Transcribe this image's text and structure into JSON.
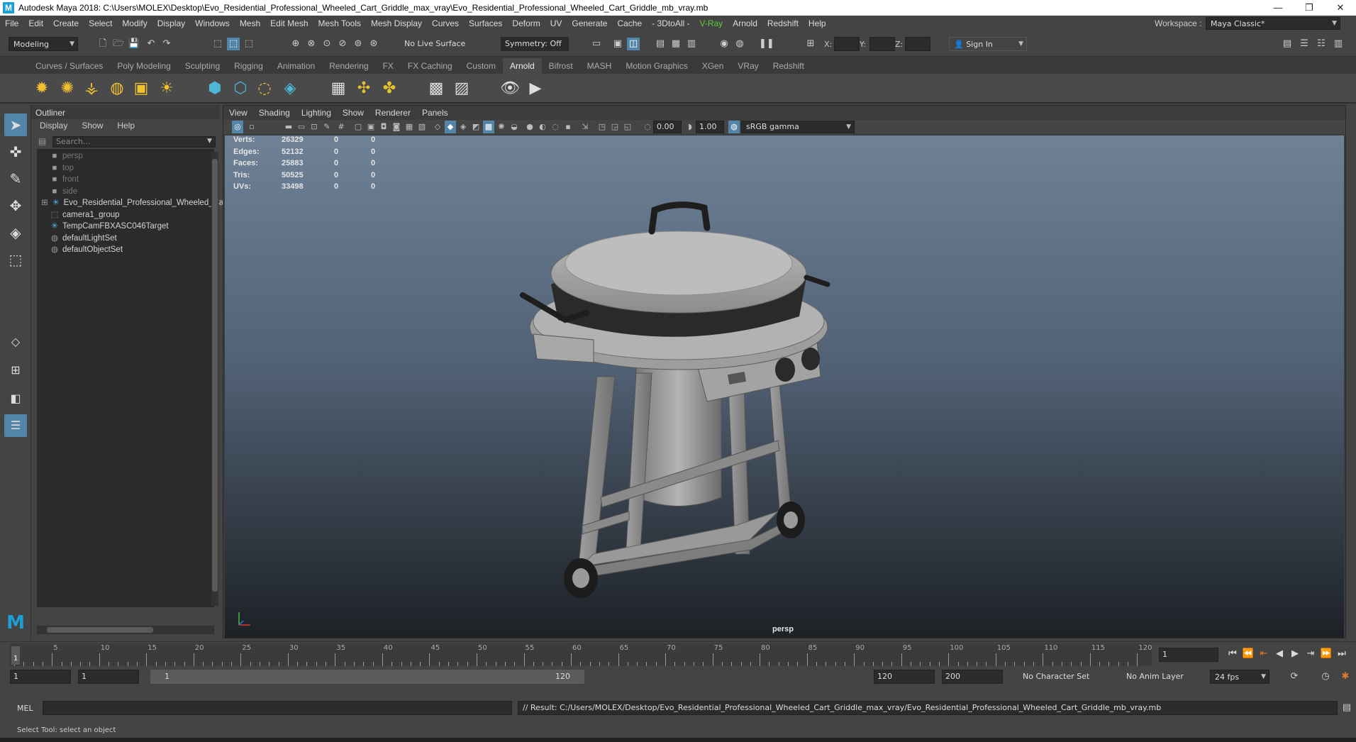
{
  "window": {
    "title": "Autodesk Maya 2018: C:\\Users\\MOLEX\\Desktop\\Evo_Residential_Professional_Wheeled_Cart_Griddle_max_vray\\Evo_Residential_Professional_Wheeled_Cart_Griddle_mb_vray.mb",
    "logo": "M",
    "minimize": "—",
    "maximize": "❐",
    "close": "✕"
  },
  "menubar": [
    "File",
    "Edit",
    "Create",
    "Select",
    "Modify",
    "Display",
    "Windows",
    "Mesh",
    "Edit Mesh",
    "Mesh Tools",
    "Mesh Display",
    "Curves",
    "Surfaces",
    "Deform",
    "UV",
    "Generate",
    "Cache",
    "- 3DtoAll -",
    "V-Ray",
    "Arnold",
    "Redshift",
    "Help"
  ],
  "workspace": {
    "label": "Workspace :",
    "value": "Maya Classic*"
  },
  "statusline": {
    "mode": "Modeling",
    "live_surface": "No Live Surface",
    "symmetry": "Symmetry: Off",
    "x_label": "X:",
    "y_label": "Y:",
    "z_label": "Z:",
    "sign_in": "Sign In"
  },
  "shelf_tabs": [
    "Curves / Surfaces",
    "Poly Modeling",
    "Sculpting",
    "Rigging",
    "Animation",
    "Rendering",
    "FX",
    "FX Caching",
    "Custom",
    "Arnold",
    "Bifrost",
    "MASH",
    "Motion Graphics",
    "XGen",
    "VRay",
    "Redshift"
  ],
  "shelf_active": "Arnold",
  "outliner": {
    "title": "Outliner",
    "menu": [
      "Display",
      "Show",
      "Help"
    ],
    "search_placeholder": "Search...",
    "items": [
      {
        "label": "persp",
        "dim": true,
        "icon": "camera-icon"
      },
      {
        "label": "top",
        "dim": true,
        "icon": "camera-icon"
      },
      {
        "label": "front",
        "dim": true,
        "icon": "camera-icon"
      },
      {
        "label": "side",
        "dim": true,
        "icon": "camera-icon"
      },
      {
        "label": "Evo_Residential_Professional_Wheeled_Cart_Griddle",
        "dim": false,
        "icon": "transform-icon"
      },
      {
        "label": "camera1_group",
        "dim": false,
        "icon": "group-icon"
      },
      {
        "label": "TempCamFBXASC046Target",
        "dim": false,
        "icon": "transform-icon"
      },
      {
        "label": "defaultLightSet",
        "dim": false,
        "icon": "set-icon"
      },
      {
        "label": "defaultObjectSet",
        "dim": false,
        "icon": "set-icon"
      }
    ]
  },
  "viewport": {
    "menu": [
      "View",
      "Shading",
      "Lighting",
      "Show",
      "Renderer",
      "Panels"
    ],
    "exposure": "0.00",
    "gamma": "1.00",
    "color_space": "sRGB gamma",
    "camera": "persp",
    "hud": [
      {
        "label": "Verts:",
        "a": "26329",
        "b": "0",
        "c": "0"
      },
      {
        "label": "Edges:",
        "a": "52132",
        "b": "0",
        "c": "0"
      },
      {
        "label": "Faces:",
        "a": "25883",
        "b": "0",
        "c": "0"
      },
      {
        "label": "Tris:",
        "a": "50525",
        "b": "0",
        "c": "0"
      },
      {
        "label": "UVs:",
        "a": "33498",
        "b": "0",
        "c": "0"
      }
    ]
  },
  "timeslider": {
    "ticks": [
      "5",
      "10",
      "15",
      "20",
      "25",
      "30",
      "35",
      "40",
      "45",
      "50",
      "55",
      "60",
      "65",
      "70",
      "75",
      "80",
      "85",
      "90",
      "95",
      "100",
      "105",
      "110",
      "115",
      "120"
    ],
    "current_frame": "1",
    "frame_field": "1"
  },
  "range": {
    "start": "1",
    "anim_start": "1",
    "slider_start": "1",
    "slider_end": "120",
    "anim_end": "120",
    "end": "200",
    "character_set": "No Character Set",
    "anim_layer": "No Anim Layer",
    "fps": "24 fps"
  },
  "cmdline": {
    "lang": "MEL",
    "result": "// Result: C:/Users/MOLEX/Desktop/Evo_Residential_Professional_Wheeled_Cart_Griddle_max_vray/Evo_Residential_Professional_Wheeled_Cart_Griddle_mb_vray.mb"
  },
  "helpline": "Select Tool: select an object"
}
